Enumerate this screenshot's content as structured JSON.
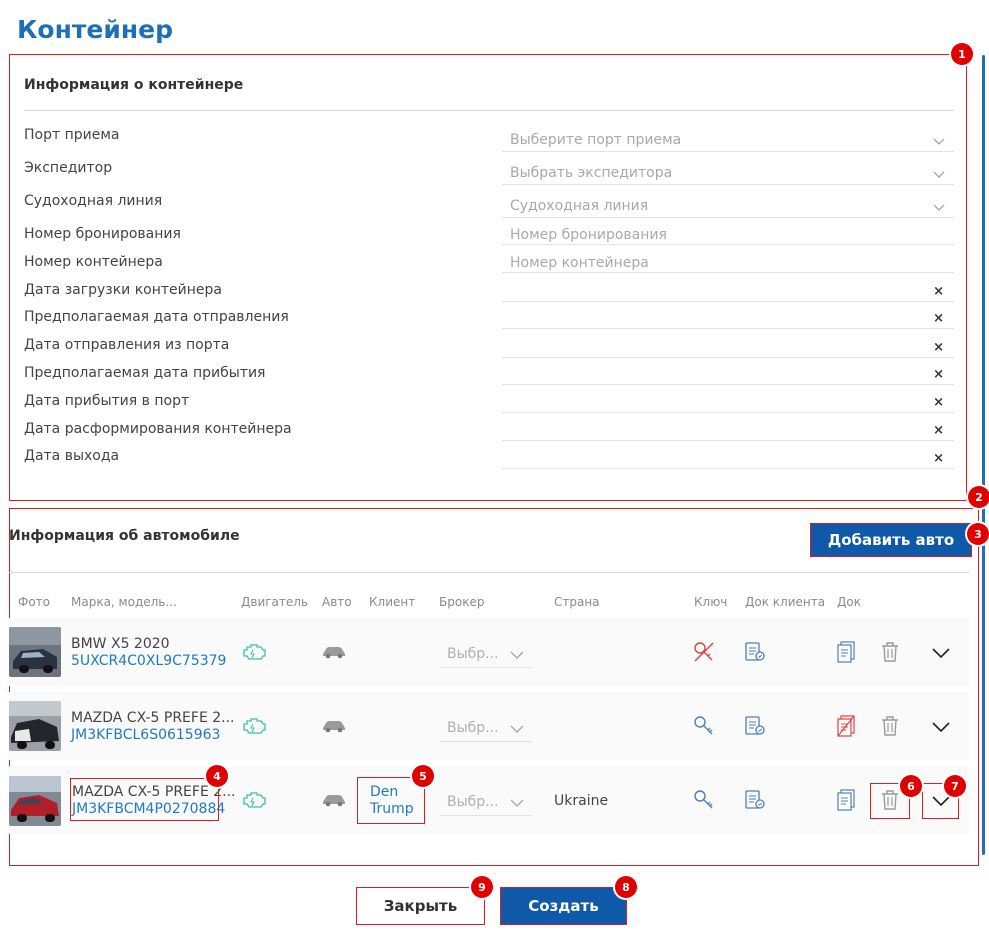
{
  "page": {
    "title": "Контейнер"
  },
  "container_info": {
    "title": "Информация о контейнере",
    "fields": [
      {
        "label": "Порт приема",
        "placeholder": "Выберите порт приема",
        "kind": "select"
      },
      {
        "label": "Экспедитор",
        "placeholder": "Выбрать экспедитора",
        "kind": "select"
      },
      {
        "label": "Судоходная линия",
        "placeholder": "Судоходная линия",
        "kind": "select"
      },
      {
        "label": "Номер бронирования",
        "placeholder": "Номер бронирования",
        "kind": "text"
      },
      {
        "label": "Номер контейнера",
        "placeholder": "Номер контейнера",
        "kind": "text"
      },
      {
        "label": "Дата загрузки контейнера",
        "placeholder": "",
        "kind": "date"
      },
      {
        "label": "Предполагаемая дата отправления",
        "placeholder": "",
        "kind": "date"
      },
      {
        "label": "Дата отправления из порта",
        "placeholder": "",
        "kind": "date"
      },
      {
        "label": "Предполагаемая дата прибытия",
        "placeholder": "",
        "kind": "date"
      },
      {
        "label": "Дата прибытия в порт",
        "placeholder": "",
        "kind": "date"
      },
      {
        "label": "Дата расформирования контейнера",
        "placeholder": "",
        "kind": "date"
      },
      {
        "label": "Дата выхода",
        "placeholder": "",
        "kind": "date"
      }
    ],
    "clear_symbol": "×"
  },
  "car_info": {
    "title": "Информация об автомобиле",
    "add_button": "Добавить авто",
    "columns": [
      "Фото",
      "Марка, модель...",
      "Двигатель",
      "Авто",
      "Клиент",
      "Брокер",
      "Страна",
      "Ключ",
      "Док клиента",
      "Док"
    ],
    "rows": [
      {
        "model": "BMW X5 2020",
        "vin": "5UXCR4C0XL9C75379",
        "client": "",
        "broker": "Выбр...",
        "country": "",
        "key_status": "missing",
        "doc_status": "ok"
      },
      {
        "model": "MAZDA CX-5 PREFE 2...",
        "vin": "JM3KFBCL6S0615963",
        "client": "",
        "broker": "Выбр...",
        "country": "",
        "key_status": "ok",
        "doc_status": "missing"
      },
      {
        "model": "MAZDA CX-5 PREFE 2...",
        "vin": "JM3KFBCM4P0270884",
        "client": "Den Trump",
        "broker": "Выбр...",
        "country": "Ukraine",
        "key_status": "ok",
        "doc_status": "ok"
      }
    ]
  },
  "footer": {
    "close_button": "Закрыть",
    "create_button": "Создать"
  },
  "annotations": [
    "1",
    "2",
    "3",
    "4",
    "5",
    "6",
    "7",
    "8",
    "9"
  ],
  "colors": {
    "accent": "#1059a8",
    "link": "#1f7bc0",
    "annotation": "#d0202a",
    "engine_icon": "#3cc2a0",
    "missing": "#e04040"
  }
}
